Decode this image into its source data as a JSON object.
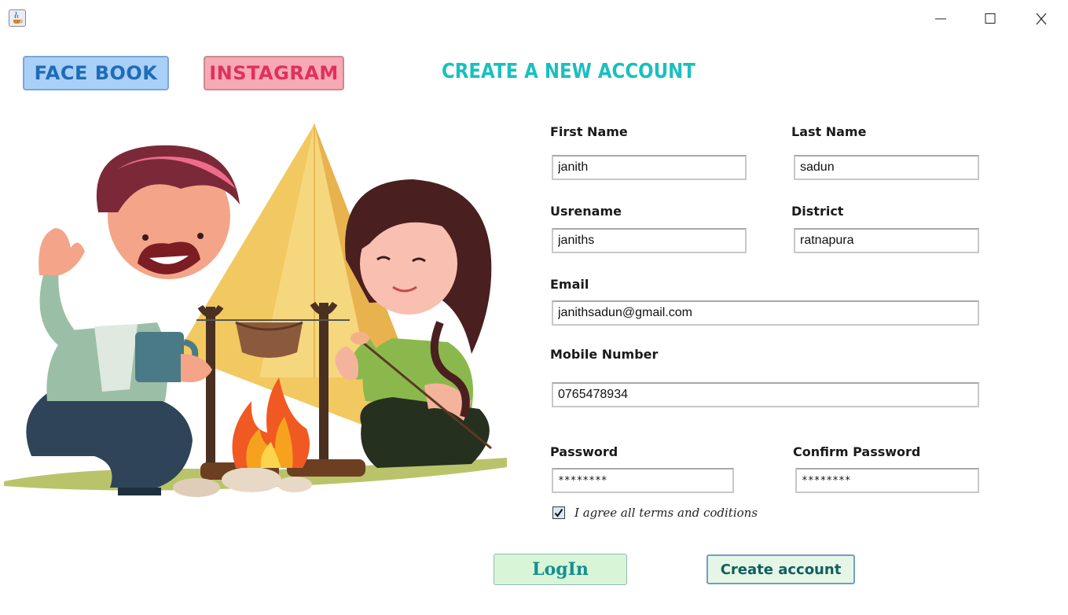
{
  "window": {
    "app_icon": "java-coffee-cup-icon",
    "controls": [
      "minimize-icon",
      "maximize-icon",
      "close-icon"
    ]
  },
  "social": {
    "facebook_label": "FACE BOOK",
    "instagram_label": "INSTAGRAM"
  },
  "title": "CREATE A NEW ACCOUNT",
  "illustration": "camping-couple-campfire-illustration",
  "form": {
    "first_name": {
      "label": "First Name",
      "value": "janith"
    },
    "last_name": {
      "label": "Last Name",
      "value": "sadun"
    },
    "username": {
      "label": "Usrename",
      "value": "janiths"
    },
    "district": {
      "label": "District",
      "value": "ratnapura"
    },
    "email": {
      "label": "Email",
      "value": "janithsadun@gmail.com"
    },
    "mobile": {
      "label": "Mobile Number",
      "value": "0765478934"
    },
    "password": {
      "label": "Password",
      "value": "********"
    },
    "confirm_password": {
      "label": "Confirm Password",
      "value": "********"
    },
    "agree": {
      "label": "I agree all terms and coditions",
      "checked": true
    }
  },
  "actions": {
    "login_label": "LogIn",
    "create_label": "Create account"
  },
  "colors": {
    "title": "#1bbfbf",
    "facebook_bg": "#a9d0f7",
    "facebook_text": "#1f6bb8",
    "instagram_bg": "#f7a9b4",
    "instagram_text": "#e0305f",
    "login_bg": "#d8f5d8",
    "create_bg": "#e6f6e6"
  }
}
